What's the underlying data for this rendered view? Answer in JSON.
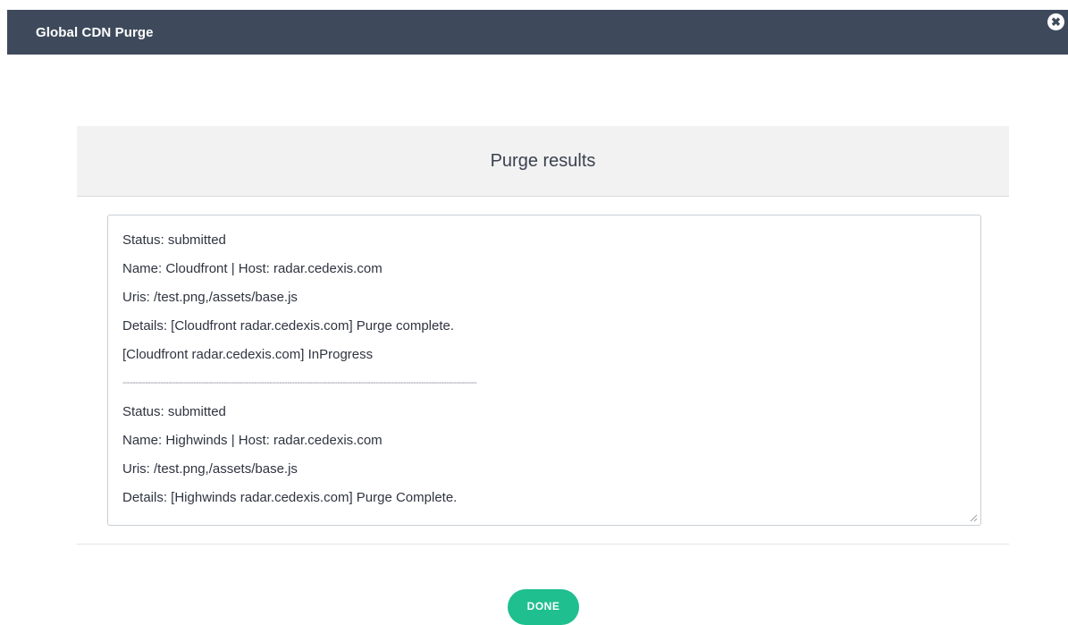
{
  "window": {
    "title": "Global CDN Purge",
    "close_icon": "close-icon",
    "close_glyph": "✖"
  },
  "results": {
    "heading": "Purge results",
    "lines": [
      "Status: submitted",
      "Name: Cloudfront | Host: radar.cedexis.com",
      "Uris: /test.png,/assets/base.js",
      "Details: [Cloudfront radar.cedexis.com] Purge complete.",
      "[Cloudfront radar.cedexis.com] InProgress",
      "--------------------------------------------------------------------------------------------------------------------------------------------",
      "Status: submitted",
      "Name: Highwinds | Host: radar.cedexis.com",
      "Uris: /test.png,/assets/base.js",
      "Details: [Highwinds radar.cedexis.com] Purge Complete."
    ]
  },
  "actions": {
    "done_label": "DONE"
  },
  "colors": {
    "titlebar": "#3e4a5c",
    "accent": "#1fbf8f",
    "header_bg": "#f2f2f2"
  }
}
